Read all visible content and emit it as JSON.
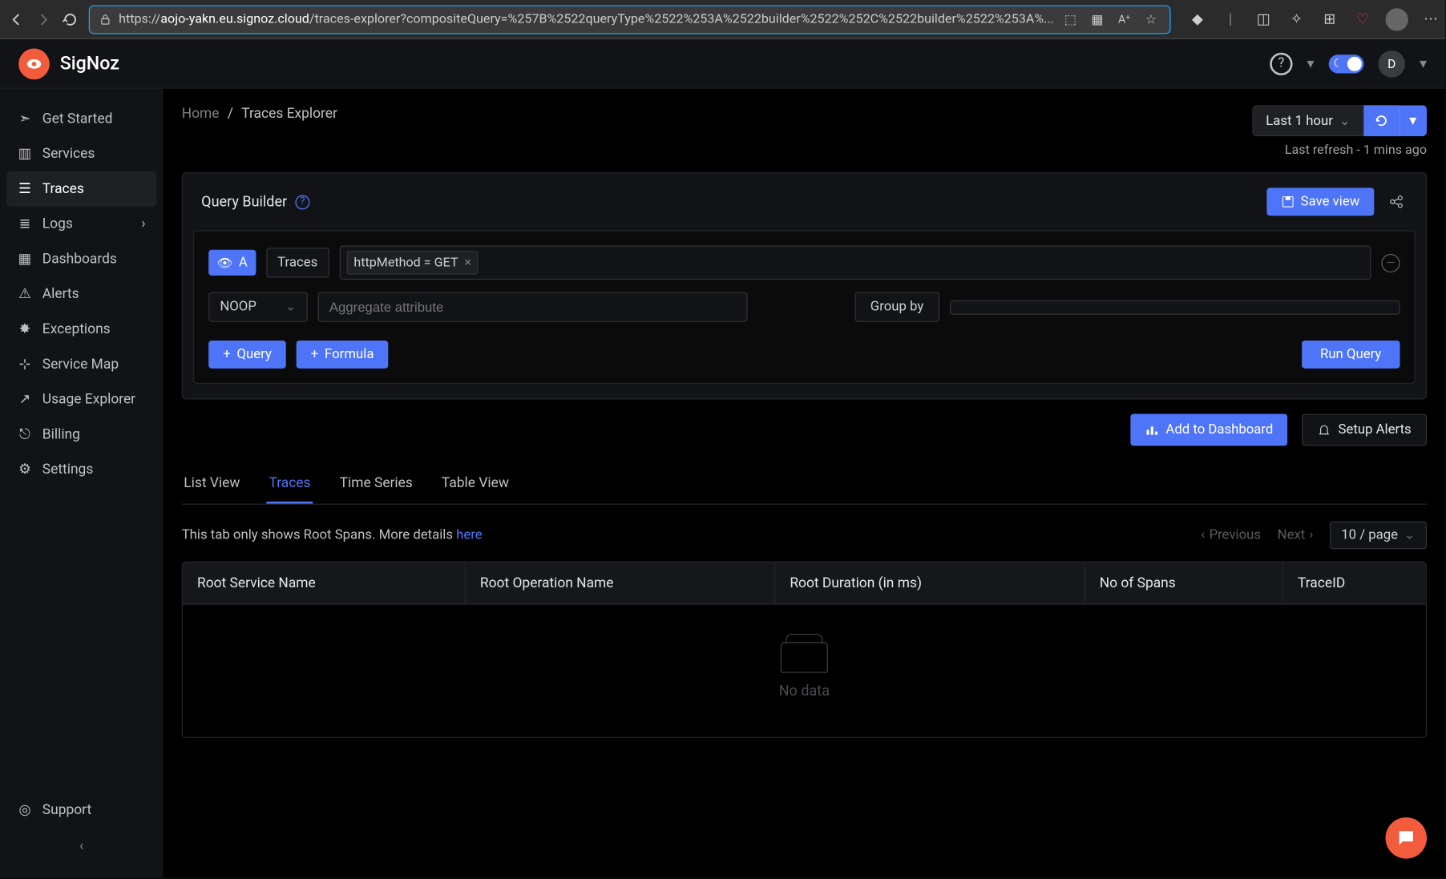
{
  "browser": {
    "url_prefix": "https://",
    "url_domain": "aojo-yakn.eu.signoz.cloud",
    "url_path": "/traces-explorer?compositeQuery=%257B%2522queryType%2522%253A%2522builder%2522%252C%2522builder%2522%253A%..."
  },
  "app": {
    "name": "SigNoz",
    "user_initial": "D"
  },
  "sidebar": {
    "items": [
      {
        "label": "Get Started"
      },
      {
        "label": "Services"
      },
      {
        "label": "Traces"
      },
      {
        "label": "Logs"
      },
      {
        "label": "Dashboards"
      },
      {
        "label": "Alerts"
      },
      {
        "label": "Exceptions"
      },
      {
        "label": "Service Map"
      },
      {
        "label": "Usage Explorer"
      },
      {
        "label": "Billing"
      },
      {
        "label": "Settings"
      }
    ],
    "support": "Support"
  },
  "breadcrumb": {
    "home": "Home",
    "sep": "/",
    "current": "Traces Explorer"
  },
  "time": {
    "range": "Last 1 hour",
    "refresh": "Last refresh - 1 mins ago"
  },
  "query_builder": {
    "title": "Query Builder",
    "save_view": "Save view",
    "chip_a": "A",
    "source": "Traces",
    "filter_tag": "httpMethod = GET",
    "noop": "NOOP",
    "agg_placeholder": "Aggregate attribute",
    "group_by": "Group by",
    "query_btn": "Query",
    "formula_btn": "Formula",
    "run_query": "Run Query"
  },
  "actions": {
    "add_dashboard": "Add to Dashboard",
    "setup_alerts": "Setup Alerts"
  },
  "tabs": [
    {
      "label": "List View"
    },
    {
      "label": "Traces"
    },
    {
      "label": "Time Series"
    },
    {
      "label": "Table View"
    }
  ],
  "root_note": {
    "text": "This tab only shows Root Spans. More details ",
    "link": "here"
  },
  "pager": {
    "previous": "Previous",
    "next": "Next",
    "page_size": "10 / page"
  },
  "table": {
    "columns": [
      "Root Service Name",
      "Root Operation Name",
      "Root Duration (in ms)",
      "No of Spans",
      "TraceID"
    ],
    "empty": "No data"
  }
}
